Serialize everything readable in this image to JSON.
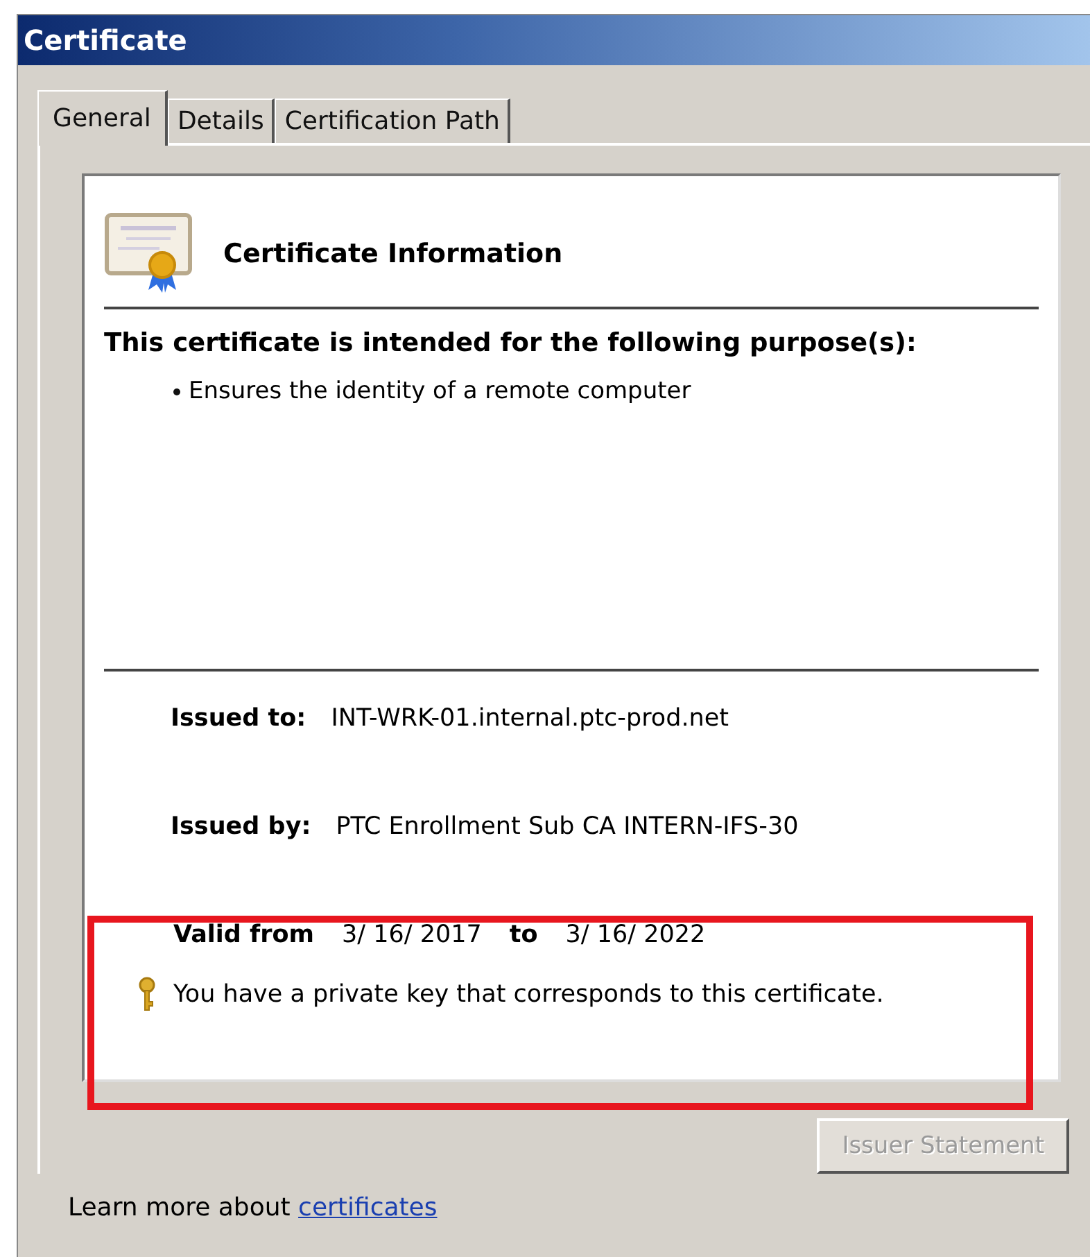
{
  "window": {
    "title": "Certificate"
  },
  "tabs": [
    {
      "label": "General",
      "selected": true
    },
    {
      "label": "Details",
      "selected": false
    },
    {
      "label": "Certification Path",
      "selected": false
    }
  ],
  "info": {
    "heading": "Certificate Information",
    "purpose_title": "This certificate is intended for the following purpose(s):",
    "purposes": [
      "Ensures the identity of a remote computer"
    ]
  },
  "issued_to": {
    "label": "Issued to:",
    "value": "INT-WRK-01.internal.ptc-prod.net"
  },
  "issued_by": {
    "label": "Issued by:",
    "value": "PTC Enrollment Sub CA INTERN-IFS-30"
  },
  "validity": {
    "from_label": "Valid from",
    "from": "3/ 16/ 2017",
    "to_label": "to",
    "to": "3/ 16/ 2022"
  },
  "private_key_note": "You have a private key that corresponds to this certificate.",
  "issuer_button": {
    "label": "Issuer Statement",
    "disabled": true
  },
  "footer": {
    "text": "Learn more about",
    "link": "certificates"
  }
}
